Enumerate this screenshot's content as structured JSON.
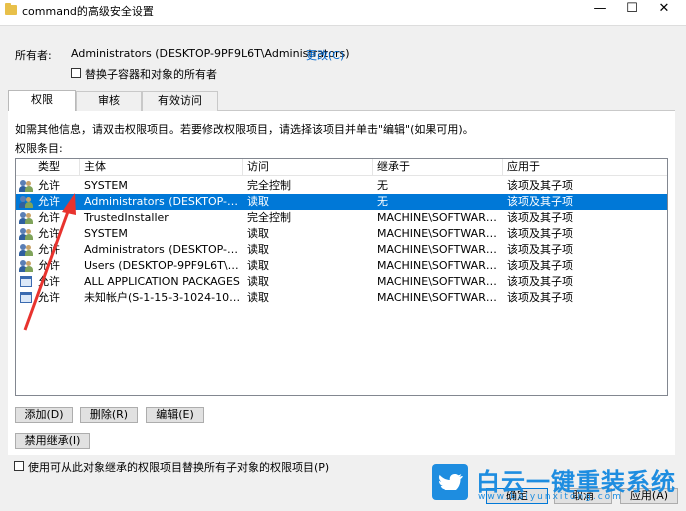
{
  "window": {
    "title": "command的高级安全设置",
    "minimize": "—",
    "maximize": "☐",
    "close": "✕"
  },
  "owner": {
    "label": "所有者:",
    "value": "Administrators (DESKTOP-9PF9L6T\\Administrators)",
    "change_link": "更改(C)",
    "replace_checkbox_label": "替换子容器和对象的所有者",
    "replace_checked": false
  },
  "tabs": [
    {
      "label": "权限",
      "active": true
    },
    {
      "label": "审核",
      "active": false
    },
    {
      "label": "有效访问",
      "active": false
    }
  ],
  "info_text": "如需其他信息，请双击权限项目。若要修改权限项目，请选择该项目并单击\"编辑\"(如果可用)。",
  "entries_label": "权限条目:",
  "columns": [
    "类型",
    "主体",
    "访问",
    "继承于",
    "应用于"
  ],
  "rows": [
    {
      "icon": "users",
      "type": "允许",
      "principal": "SYSTEM",
      "access": "完全控制",
      "inherited": "无",
      "applies": "该项及其子项",
      "selected": false
    },
    {
      "icon": "users",
      "type": "允许",
      "principal": "Administrators (DESKTOP-9PF9L...",
      "access": "读取",
      "inherited": "无",
      "applies": "该项及其子项",
      "selected": true
    },
    {
      "icon": "users",
      "type": "允许",
      "principal": "TrustedInstaller",
      "access": "完全控制",
      "inherited": "MACHINE\\SOFTWARE\\Cl...",
      "applies": "该项及其子项",
      "selected": false
    },
    {
      "icon": "users",
      "type": "允许",
      "principal": "SYSTEM",
      "access": "读取",
      "inherited": "MACHINE\\SOFTWARE\\Cl...",
      "applies": "该项及其子项",
      "selected": false
    },
    {
      "icon": "users",
      "type": "允许",
      "principal": "Administrators (DESKTOP-9PF9L...",
      "access": "读取",
      "inherited": "MACHINE\\SOFTWARE\\Cl...",
      "applies": "该项及其子项",
      "selected": false
    },
    {
      "icon": "users",
      "type": "允许",
      "principal": "Users (DESKTOP-9PF9L6T\\Users)",
      "access": "读取",
      "inherited": "MACHINE\\SOFTWARE\\Cl...",
      "applies": "该项及其子项",
      "selected": false
    },
    {
      "icon": "app",
      "type": "允许",
      "principal": "ALL APPLICATION PACKAGES",
      "access": "读取",
      "inherited": "MACHINE\\SOFTWARE\\Cl...",
      "applies": "该项及其子项",
      "selected": false
    },
    {
      "icon": "app",
      "type": "允许",
      "principal": "未知帐户(S-1-15-3-1024-1065365...",
      "access": "读取",
      "inherited": "MACHINE\\SOFTWARE\\Cl...",
      "applies": "该项及其子项",
      "selected": false
    }
  ],
  "buttons": {
    "add": "添加(D)",
    "remove": "删除(R)",
    "edit": "编辑(E)",
    "disable_inheritance": "禁用继承(I)"
  },
  "replace_child_checkbox": {
    "label": "使用可从此对象继承的权限项目替换所有子对象的权限项目(P)",
    "checked": false
  },
  "footer": {
    "ok": "确定",
    "cancel": "取消",
    "apply": "应用(A)"
  },
  "watermark": {
    "text": "白云一键重装系统",
    "url": "www.baiyunxitong.com"
  },
  "colors": {
    "selection": "#0078d7",
    "link": "#0066cc",
    "annotation_arrow": "#e8332e",
    "watermark": "#1e8de0"
  }
}
